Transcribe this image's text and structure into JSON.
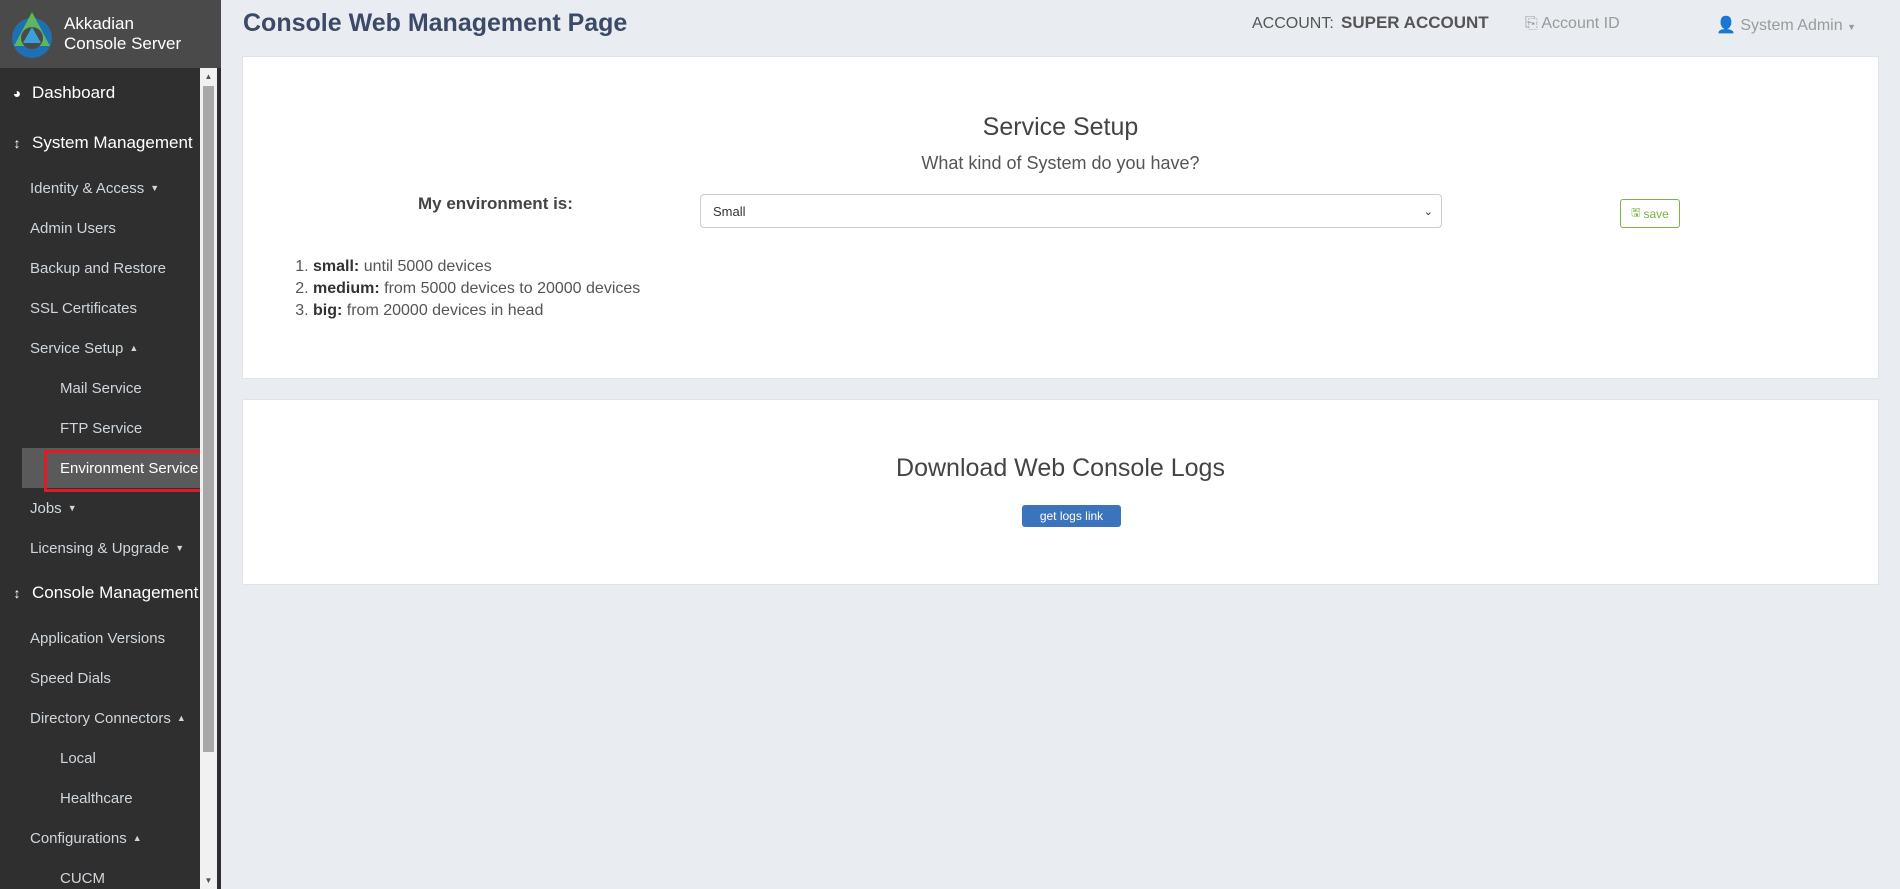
{
  "brand": {
    "line1": "Akkadian",
    "line2": "Console Server"
  },
  "header": {
    "title": "Console Web Management Page",
    "account_label": "ACCOUNT:",
    "account_value": "SUPER ACCOUNT",
    "account_id": "Account ID",
    "user": "System Admin"
  },
  "sidebar": {
    "items": [
      {
        "label": "Dashboard"
      },
      {
        "label": "System Management"
      },
      {
        "label": "Identity & Access"
      },
      {
        "label": "Admin Users"
      },
      {
        "label": "Backup and Restore"
      },
      {
        "label": "SSL Certificates"
      },
      {
        "label": "Service Setup"
      },
      {
        "label": "Mail Service"
      },
      {
        "label": "FTP Service"
      },
      {
        "label": "Environment Service"
      },
      {
        "label": "Jobs"
      },
      {
        "label": "Licensing & Upgrade"
      },
      {
        "label": "Console Management"
      },
      {
        "label": "Application Versions"
      },
      {
        "label": "Speed Dials"
      },
      {
        "label": "Directory Connectors"
      },
      {
        "label": "Local"
      },
      {
        "label": "Healthcare"
      },
      {
        "label": "Configurations"
      },
      {
        "label": "CUCM"
      }
    ]
  },
  "service_setup": {
    "title": "Service Setup",
    "subtitle": "What kind of System do you have?",
    "env_label": "My environment is:",
    "env_selected": "Small",
    "save_label": "save",
    "list": [
      {
        "term": "small:",
        "desc": " until 5000 devices"
      },
      {
        "term": "medium:",
        "desc": " from 5000 devices to 20000 devices"
      },
      {
        "term": "big:",
        "desc": " from 20000 devices in head"
      }
    ]
  },
  "logs": {
    "title": "Download Web Console Logs",
    "button_label": "get logs link"
  },
  "colors": {
    "sidebar_bg": "#2f2f2f",
    "brand_bg": "#4a4a4a",
    "active_item_bg": "#5a5a5a",
    "highlight": "#e01b24",
    "title": "#3b4a66",
    "save": "#7cb342",
    "primary_button": "#3b74bd"
  },
  "icons": {
    "dashboard": "dashboard-icon",
    "system_management": "arrows-vertical-icon",
    "console_management": "arrows-vertical-icon",
    "account_id": "clipboard-icon",
    "user": "user-icon",
    "save": "floppy-disk-icon"
  }
}
